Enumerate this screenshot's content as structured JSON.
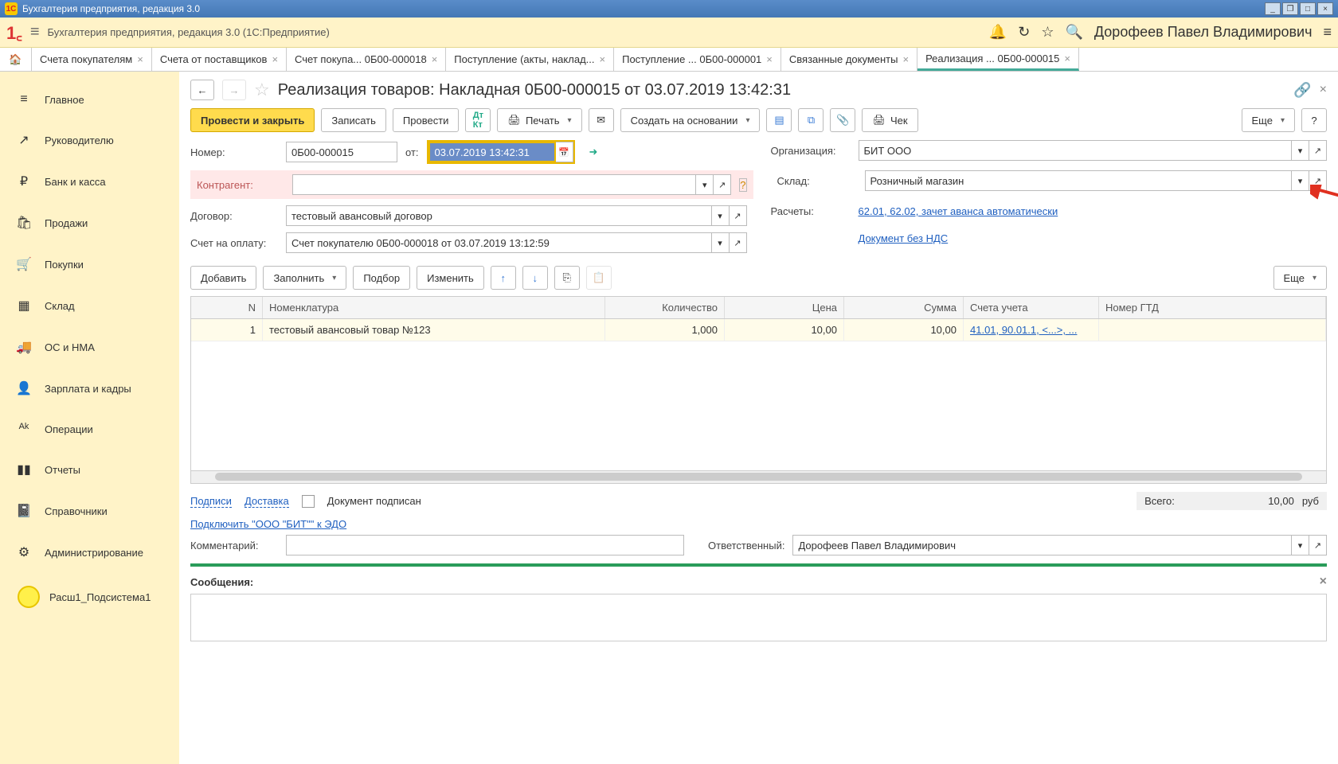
{
  "window_title": "Бухгалтерия предприятия, редакция 3.0",
  "topbar": {
    "title": "Бухгалтерия предприятия, редакция 3.0  (1С:Предприятие)",
    "user": "Дорофеев Павел Владимирович"
  },
  "tabs": [
    "Счета покупателям",
    "Счета от поставщиков",
    "Счет покупа...   0Б00-000018",
    "Поступление (акты, наклад...",
    "Поступление ...   0Б00-000001",
    "Связанные документы",
    "Реализация ...   0Б00-000015"
  ],
  "sidebar": [
    {
      "icon": "≡",
      "label": "Главное"
    },
    {
      "icon": "↗",
      "label": "Руководителю"
    },
    {
      "icon": "₽",
      "label": "Банк и касса"
    },
    {
      "icon": "🛍",
      "label": "Продажи"
    },
    {
      "icon": "🛒",
      "label": "Покупки"
    },
    {
      "icon": "▦",
      "label": "Склад"
    },
    {
      "icon": "🚚",
      "label": "ОС и НМА"
    },
    {
      "icon": "👤",
      "label": "Зарплата и кадры"
    },
    {
      "icon": "ᴬᵏ",
      "label": "Операции"
    },
    {
      "icon": "▮▮",
      "label": "Отчеты"
    },
    {
      "icon": "📓",
      "label": "Справочники"
    },
    {
      "icon": "⚙",
      "label": "Администрирование"
    }
  ],
  "sidebar_extra": "Расш1_Подсистема1",
  "page_title": "Реализация товаров: Накладная 0Б00-000015 от 03.07.2019 13:42:31",
  "toolbar": {
    "post_close": "Провести и закрыть",
    "save": "Записать",
    "post": "Провести",
    "print": "Печать",
    "create_based": "Создать на основании",
    "check": "Чек",
    "more": "Еще"
  },
  "form": {
    "number_lbl": "Номер:",
    "number": "0Б00-000015",
    "from": "от:",
    "date": "03.07.2019 13:42:31",
    "org_lbl": "Организация:",
    "org": "БИТ ООО",
    "counterparty_lbl": "Контрагент:",
    "warehouse_lbl": "Склад:",
    "warehouse": "Розничный магазин",
    "contract_lbl": "Договор:",
    "contract": "тестовый авансовый договор",
    "calc_lbl": "Расчеты:",
    "calc_link": "62.01, 62.02, зачет аванса автоматически",
    "novatndс": "Документ без НДС",
    "invoice_lbl": "Счет на оплату:",
    "invoice": "Счет покупателю 0Б00-000018 от 03.07.2019 13:12:59"
  },
  "table_toolbar": {
    "add": "Добавить",
    "fill": "Заполнить",
    "select": "Подбор",
    "edit": "Изменить",
    "more": "Еще"
  },
  "columns": {
    "n": "N",
    "nom": "Номенклатура",
    "qty": "Количество",
    "price": "Цена",
    "sum": "Сумма",
    "acct": "Счета учета",
    "gtd": "Номер ГТД"
  },
  "row": {
    "n": "1",
    "nom": "тестовый авансовый товар №123",
    "qty": "1,000",
    "price": "10,00",
    "sum": "10,00",
    "acct": "41.01, 90.01.1, <...>, ..."
  },
  "footer": {
    "signatures": "Подписи",
    "delivery": "Доставка",
    "doc_signed": "Документ подписан",
    "total_lbl": "Всего:",
    "total": "10,00",
    "currency": "руб",
    "edo": "Подключить \"ООО \"БИТ\"\" к ЭДО",
    "comment_lbl": "Комментарий:",
    "responsible_lbl": "Ответственный:",
    "responsible": "Дорофеев Павел Владимирович"
  },
  "messages": "Сообщения:"
}
